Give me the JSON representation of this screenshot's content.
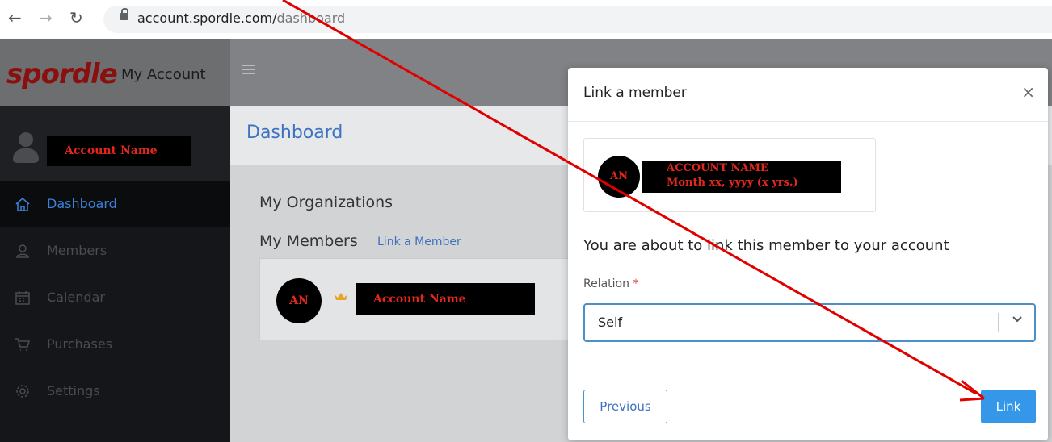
{
  "browser": {
    "url_domain": "account.spordle.com/",
    "url_path": "dashboard"
  },
  "header": {
    "logo": "spordle",
    "brand": "My Account"
  },
  "sidebar": {
    "account_name": "Account Name",
    "items": [
      {
        "label": "Dashboard",
        "icon": "home-icon",
        "active": true
      },
      {
        "label": "Members",
        "icon": "user-icon",
        "active": false
      },
      {
        "label": "Calendar",
        "icon": "calendar-icon",
        "active": false
      },
      {
        "label": "Purchases",
        "icon": "cart-icon",
        "active": false
      },
      {
        "label": "Settings",
        "icon": "gear-icon",
        "active": false
      }
    ]
  },
  "main": {
    "title": "Dashboard",
    "organizations_heading": "My Organizations",
    "members_heading": "My Members",
    "link_member_link": "Link a Member",
    "member_card": {
      "initials": "AN",
      "name": "Account Name"
    }
  },
  "modal": {
    "title": "Link a member",
    "close": "×",
    "member_initials": "AN",
    "member_name": "ACCOUNT NAME",
    "member_dob": "Month xx, yyyy (x yrs.)",
    "message": "You are about to link this member to your account",
    "relation_label": "Relation",
    "required_mark": "*",
    "relation_value": "Self",
    "previous_button": "Previous",
    "link_button": "Link"
  },
  "colors": {
    "accent": "#3597ea",
    "annotation_arrow": "#e00000",
    "redacted_text": "#e2281c"
  }
}
